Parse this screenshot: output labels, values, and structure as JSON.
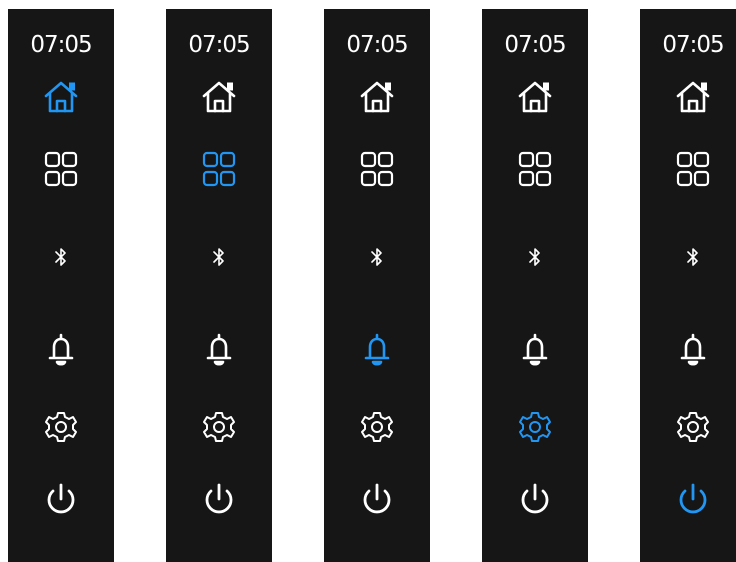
{
  "colors": {
    "background": "#161616",
    "icon": "#ffffff",
    "active": "#2196f3"
  },
  "panels": [
    {
      "time": "07:05",
      "active": "home"
    },
    {
      "time": "07:05",
      "active": "apps"
    },
    {
      "time": "07:05",
      "active": "notifications"
    },
    {
      "time": "07:05",
      "active": "settings"
    },
    {
      "time": "07:05",
      "active": "power"
    }
  ],
  "icons": [
    "home-icon",
    "apps-icon",
    "bluetooth-icon",
    "bell-icon",
    "gear-icon",
    "power-icon"
  ]
}
